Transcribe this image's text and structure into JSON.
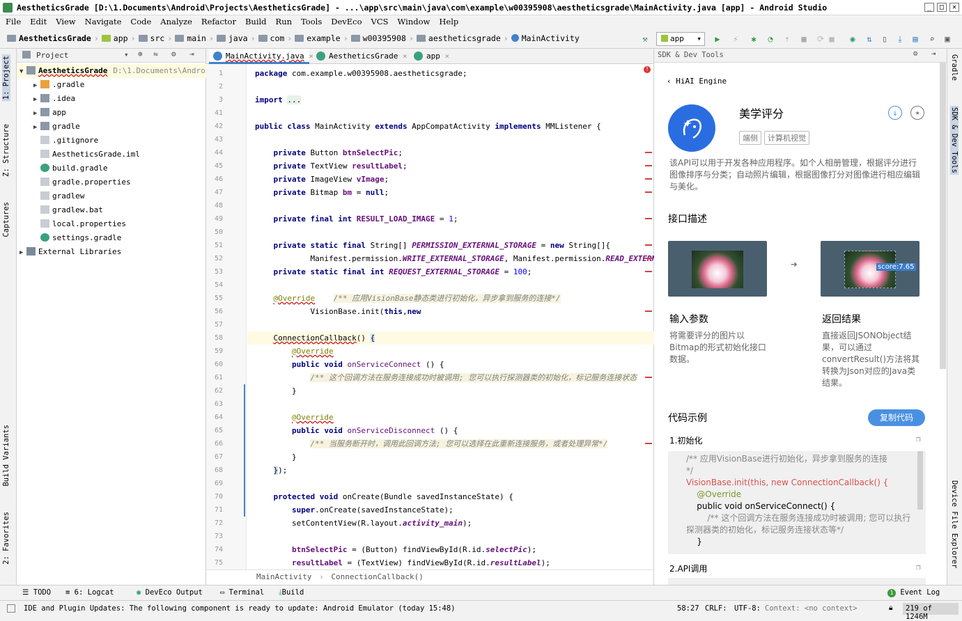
{
  "titlebar": {
    "title": "AestheticsGrade [D:\\1.Documents\\Android\\Projects\\AestheticsGrade] - ...\\app\\src\\main\\java\\com\\example\\w00395908\\aestheticsgrade\\MainActivity.java [app] - Android Studio",
    "minimize": "_",
    "maximize": "□",
    "close": "✕"
  },
  "menu": [
    "File",
    "Edit",
    "View",
    "Navigate",
    "Code",
    "Analyze",
    "Refactor",
    "Build",
    "Run",
    "Tools",
    "DevEco",
    "VCS",
    "Window",
    "Help"
  ],
  "breadcrumbs": [
    "AestheticsGrade",
    "app",
    "src",
    "main",
    "java",
    "com",
    "example",
    "w00395908",
    "aestheticsgrade",
    "MainActivity"
  ],
  "run_config": "app",
  "left_tabs": [
    "1: Project",
    "Z: Structure",
    "Captures",
    "Build Variants",
    "2: Favorites"
  ],
  "project_panel": {
    "title": "Project",
    "tree": [
      {
        "label": "AestheticsGrade",
        "extra": "D:\\1.Documents\\Androi",
        "level": 0,
        "arrow": "▼",
        "icon": "folder"
      },
      {
        "label": ".gradle",
        "level": 1,
        "arrow": "▶",
        "icon": "folder-orange"
      },
      {
        "label": ".idea",
        "level": 1,
        "arrow": "▶",
        "icon": "folder"
      },
      {
        "label": "app",
        "level": 1,
        "arrow": "▶",
        "icon": "folder"
      },
      {
        "label": "gradle",
        "level": 1,
        "arrow": "▶",
        "icon": "folder"
      },
      {
        "label": ".gitignore",
        "level": 1,
        "arrow": "",
        "icon": "file"
      },
      {
        "label": "AestheticsGrade.iml",
        "level": 1,
        "arrow": "",
        "icon": "file"
      },
      {
        "label": "build.gradle",
        "level": 1,
        "arrow": "",
        "icon": "gradle"
      },
      {
        "label": "gradle.properties",
        "level": 1,
        "arrow": "",
        "icon": "file"
      },
      {
        "label": "gradlew",
        "level": 1,
        "arrow": "",
        "icon": "file"
      },
      {
        "label": "gradlew.bat",
        "level": 1,
        "arrow": "",
        "icon": "file"
      },
      {
        "label": "local.properties",
        "level": 1,
        "arrow": "",
        "icon": "file"
      },
      {
        "label": "settings.gradle",
        "level": 1,
        "arrow": "",
        "icon": "gradle"
      },
      {
        "label": "External Libraries",
        "level": 0,
        "arrow": "▶",
        "icon": "lib"
      }
    ]
  },
  "editor_tabs": [
    {
      "label": "MainActivity.java",
      "active": true
    },
    {
      "label": "AestheticsGrade",
      "active": false
    },
    {
      "label": "app",
      "active": false
    }
  ],
  "code_lines": [
    {
      "n": "1",
      "html": "<span class='kw'>package</span> com.example.w00395908.aestheticsgrade;"
    },
    {
      "n": "2",
      "html": ""
    },
    {
      "n": "3",
      "html": "<span class='kw'>import</span> <span style='background:#e8f2e8'>...</span>"
    },
    {
      "n": "41",
      "html": ""
    },
    {
      "n": "42",
      "html": "<span class='kw'>public class</span> MainActivity <span class='kw'>extends</span> AppCompatActivity <span class='kw'>implements</span> MMListener {"
    },
    {
      "n": "43",
      "html": ""
    },
    {
      "n": "44",
      "html": "    <span class='kw'>private</span> Button <span class='fld'>btnSelectPic</span>;"
    },
    {
      "n": "45",
      "html": "    <span class='kw'>private</span> TextView <span class='fld'>resultLabel</span>;"
    },
    {
      "n": "46",
      "html": "    <span class='kw'>private</span> ImageView <span class='fld'>vImage</span>;"
    },
    {
      "n": "47",
      "html": "    <span class='kw'>private</span> Bitmap <span class='fld'>bm</span> = <span class='kw'>null</span>;"
    },
    {
      "n": "48",
      "html": ""
    },
    {
      "n": "49",
      "html": "    <span class='kw'>private final int</span> <span class='fld'>RESULT_LOAD_IMAGE</span> = <span class='num'>1</span>;"
    },
    {
      "n": "50",
      "html": ""
    },
    {
      "n": "51",
      "html": "    <span class='kw'>private static final</span> String[] <span class='cst'>PERMISSION_EXTERNAL_STORAGE</span> = <span class='kw'>new</span> String[]{"
    },
    {
      "n": "52",
      "html": "            Manifest.permission.<span class='cst'>WRITE_EXTERNAL_STORAGE</span>, Manifest.permission.<span class='cst'>READ_EXTERNAL_</span>"
    },
    {
      "n": "53",
      "html": "    <span class='kw'>private static final int</span> <span class='cst'>REQUEST_EXTERNAL_STORAGE</span> = <span class='num'>100</span>;"
    },
    {
      "n": "54",
      "html": ""
    },
    {
      "n": "55",
      "html": "    <span class='ann' style='text-decoration:underline wavy #c00'>@Override</span>    <span class='cmt cmtb'>/** 应用VisionBase静态类进行初始化，异步拿到服务的连接*/</span>"
    },
    {
      "n": "56",
      "html": "            VisionBase.init(<span class='kw'>this</span>,<span class='kw'>new</span>"
    },
    {
      "n": "57",
      "html": ""
    },
    {
      "n": "58",
      "html": "    <span style='text-decoration:underline wavy #c00'>ConnectionCallback</span>() <span style='background:#cfe3f7'>{</span>"
    },
    {
      "n": "59",
      "html": "        <span class='ann' style='text-decoration:underline wavy #c00'>@Override</span>"
    },
    {
      "n": "60",
      "html": "        <span class='kw'>public void</span> <span class='met'>onServiceConnect</span> () {"
    },
    {
      "n": "61",
      "html": "            <span class='cmt cmtb'>/** 这个回调方法在服务连接成功时被调用; 您可以执行探测器类的初始化，标记服务连接状态</span>"
    },
    {
      "n": "62",
      "html": "        }"
    },
    {
      "n": "63",
      "html": ""
    },
    {
      "n": "64",
      "html": "        <span class='ann' style='text-decoration:underline wavy #c00'>@Override</span>"
    },
    {
      "n": "65",
      "html": "        <span class='kw'>public void</span> <span class='met'>onServiceDisconnect</span> () {"
    },
    {
      "n": "66",
      "html": "            <span class='cmt cmtb'>/** 当服务断开时，调用此回调方法; 您可以选择在此重新连接服务，或者处理异常*/</span>"
    },
    {
      "n": "67",
      "html": "        }"
    },
    {
      "n": "68",
      "html": "    <span style='background:#cfe3f7'>}</span>);"
    },
    {
      "n": "69",
      "html": ""
    },
    {
      "n": "70",
      "html": "    <span class='kw'>protected void</span> onCreate(Bundle savedInstanceState) {"
    },
    {
      "n": "71",
      "html": "        <span class='kw'>super</span>.onCreate(savedInstanceState);"
    },
    {
      "n": "72",
      "html": "        setContentView(R.layout.<span class='cst'>activity_main</span>);"
    },
    {
      "n": "73",
      "html": ""
    },
    {
      "n": "74",
      "html": "        <span class='fld'>btnSelectPic</span> = (Button) findViewById(R.id.<span class='cst'>selectPic</span>);"
    },
    {
      "n": "75",
      "html": "        <span class='fld'>resultLabel</span> = (TextView) findViewById(R.id.<span class='cst'>resultLabel</span>);"
    }
  ],
  "editor_breadcrumb": [
    "MainActivity",
    "ConnectionCallback()"
  ],
  "sdk_panel": {
    "header": "SDK & Dev Tools",
    "back": "HiAI Engine",
    "api_title": "美学评分",
    "tags": [
      "端侧",
      "计算机视觉"
    ],
    "description": "该API可以用于开发各种应用程序。如个人相册管理，根据评分进行图像排序与分类；自动照片编辑，根据图像打分对图像进行相应编辑与美化。",
    "interface_heading": "接口描述",
    "score_badge": "score:7.65",
    "input_heading": "输入参数",
    "input_text": "将需要评分的图片以Bitmap的形式初始化接口数据。",
    "output_heading": "返回结果",
    "output_text": "直接返回JSONObject结果，可以通过convertResult()方法将其转换为Json对应的Java类结果。",
    "code_heading": "代码示例",
    "copy_button": "复制代码",
    "section1": "1.初始化",
    "section2": "2.API调用",
    "code_sample": [
      "/** 应用VisionBase进行初始化，异步拿到服务的连接",
      "*/",
      "VisionBase.init(this, new ConnectionCallback() {",
      "    @Override",
      "    public void onServiceConnect() {",
      "        /** 这个回调方法在服务连接成功时被调用; 您可以执行",
      "探测器类的初始化，标记服务连接状态等*/",
      "    }"
    ]
  },
  "right_tabs": [
    "Gradle",
    "SDK & Dev Tools",
    "Device File Explorer"
  ],
  "bottom_tabs": [
    "TODO",
    "6: Logcat",
    "DevEco Output",
    "Terminal",
    "Build"
  ],
  "event_log": {
    "count": "1",
    "label": "Event Log"
  },
  "status": {
    "message": "IDE and Plugin Updates: The following component is ready to update: Android Emulator (today 15:48)",
    "position": "58:27",
    "line_sep": "CRLF:",
    "encoding": "UTF-8:",
    "context": "Context: <no context>",
    "memory": "219 of 1246M"
  },
  "colors": {
    "accent": "#4083c9",
    "hiai_blue": "#2a6de0",
    "copy_btn": "#4a90e2"
  }
}
